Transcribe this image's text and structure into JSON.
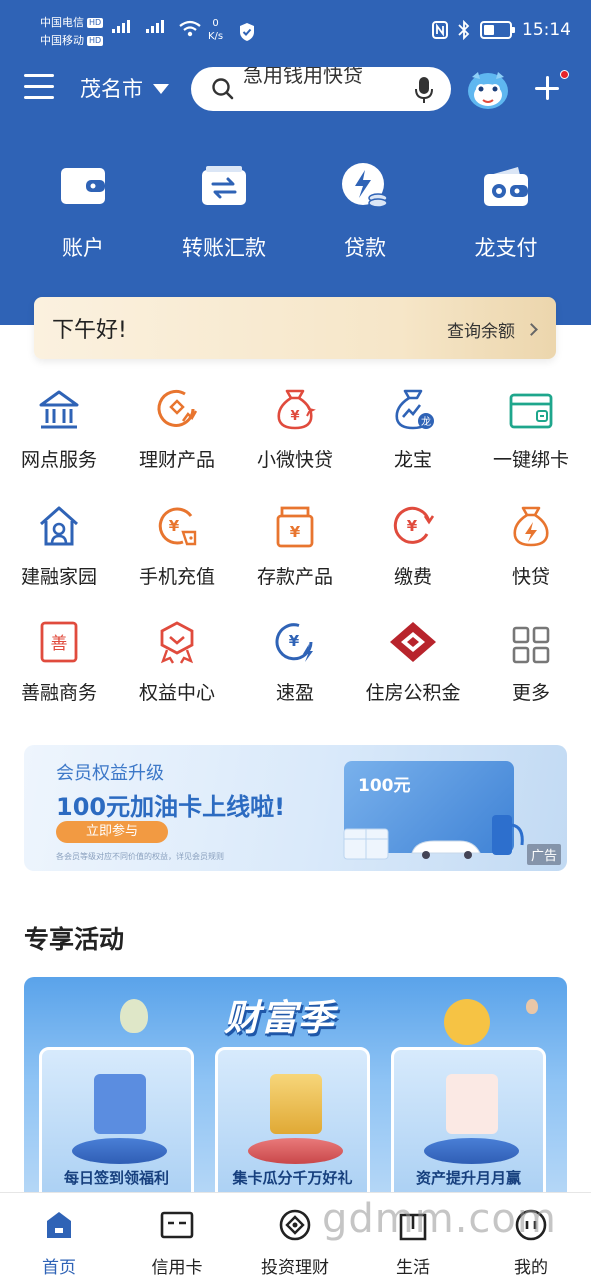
{
  "status_bar": {
    "carrier1": "中国电信",
    "carrier2": "中国移动",
    "hd": "HD",
    "net_speed_value": "0",
    "net_speed_unit": "K/s",
    "time": "15:14",
    "signal_icon_1": "signal-bars-icon",
    "signal_icon_2": "signal-bars-icon",
    "wifi_icon": "wifi-icon",
    "nfc_icon": "nfc-icon",
    "bluetooth_icon": "bluetooth-icon",
    "battery_icon": "battery-icon"
  },
  "header": {
    "city": "茂名市",
    "search_placeholder": "急用钱用快贷",
    "brand_color": "#2f63b6"
  },
  "main_actions": [
    {
      "label": "账户",
      "icon": "wallet-icon"
    },
    {
      "label": "转账汇款",
      "icon": "transfer-icon"
    },
    {
      "label": "贷款",
      "icon": "loan-icon"
    },
    {
      "label": "龙支付",
      "icon": "long-pay-icon"
    }
  ],
  "greeting": {
    "text": "下午好!",
    "query_balance": "查询余额"
  },
  "services": [
    {
      "label": "网点服务",
      "icon": "bank-branch-icon",
      "color": "#2f63b6"
    },
    {
      "label": "理财产品",
      "icon": "wealth-product-icon",
      "color": "#e8752f"
    },
    {
      "label": "小微快贷",
      "icon": "money-bag-icon",
      "color": "#e04b3d"
    },
    {
      "label": "龙宝",
      "icon": "long-bao-icon",
      "color": "#2f63b6"
    },
    {
      "label": "一键绑卡",
      "icon": "bind-card-icon",
      "color": "#1ea68c"
    },
    {
      "label": "建融家园",
      "icon": "home-icon",
      "color": "#2f63b6"
    },
    {
      "label": "手机充值",
      "icon": "phone-recharge-icon",
      "color": "#e8752f"
    },
    {
      "label": "存款产品",
      "icon": "deposit-icon",
      "color": "#e8752f"
    },
    {
      "label": "缴费",
      "icon": "payment-icon",
      "color": "#e04b3d"
    },
    {
      "label": "快贷",
      "icon": "quick-loan-icon",
      "color": "#e8752f"
    },
    {
      "label": "善融商务",
      "icon": "shanrong-icon",
      "color": "#e04b3d"
    },
    {
      "label": "权益中心",
      "icon": "rights-center-icon",
      "color": "#e04b3d"
    },
    {
      "label": "速盈",
      "icon": "suying-icon",
      "color": "#2f63b6"
    },
    {
      "label": "住房公积金",
      "icon": "housing-fund-icon",
      "color": "#b8242c"
    },
    {
      "label": "更多",
      "icon": "more-grid-icon",
      "color": "#888888"
    }
  ],
  "ad_banner": {
    "title": "会员权益升级",
    "headline": "100元加油卡上线啦!",
    "button": "立即参与",
    "note": "各会员等级对应不同价值的权益，详见会员规则",
    "card_amount": "100元",
    "tag": "广告"
  },
  "section_title": "专享活动",
  "activity_banner": {
    "logo_text": "财富季",
    "cards": [
      {
        "label": "每日签到领福利"
      },
      {
        "label": "集卡瓜分千万好礼"
      },
      {
        "label": "资产提升月月赢"
      }
    ]
  },
  "tabbar": [
    {
      "label": "首页",
      "icon": "home-tab-icon",
      "active": true
    },
    {
      "label": "信用卡",
      "icon": "credit-card-icon",
      "active": false
    },
    {
      "label": "投资理财",
      "icon": "investment-icon",
      "active": false
    },
    {
      "label": "生活",
      "icon": "life-icon",
      "active": false
    },
    {
      "label": "我的",
      "icon": "profile-icon",
      "active": false
    }
  ],
  "watermark": "gdmm.com"
}
